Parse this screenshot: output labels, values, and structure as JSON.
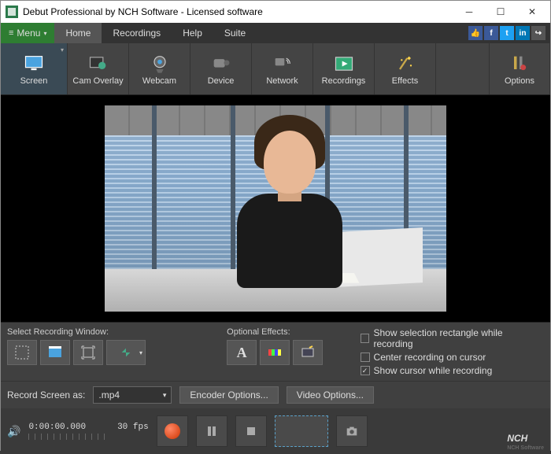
{
  "window": {
    "title": "Debut Professional by NCH Software - Licensed software"
  },
  "menu": {
    "button": "Menu",
    "tabs": [
      "Home",
      "Recordings",
      "Help",
      "Suite"
    ],
    "active": 0
  },
  "toolbar": [
    {
      "label": "Screen",
      "icon": "screen"
    },
    {
      "label": "Cam Overlay",
      "icon": "cam-overlay"
    },
    {
      "label": "Webcam",
      "icon": "webcam"
    },
    {
      "label": "Device",
      "icon": "device"
    },
    {
      "label": "Network",
      "icon": "network"
    },
    {
      "label": "Recordings",
      "icon": "recordings"
    },
    {
      "label": "Effects",
      "icon": "effects"
    },
    {
      "label": "Options",
      "icon": "options"
    }
  ],
  "recording_window": {
    "label": "Select Recording Window:"
  },
  "optional_effects": {
    "label": "Optional Effects:"
  },
  "checks": [
    {
      "label": "Show selection rectangle while recording",
      "checked": false
    },
    {
      "label": "Center recording on cursor",
      "checked": false
    },
    {
      "label": "Show cursor while recording",
      "checked": true
    }
  ],
  "format": {
    "label": "Record Screen as:",
    "value": ".mp4",
    "encoder_btn": "Encoder Options...",
    "video_btn": "Video Options..."
  },
  "transport": {
    "timecode": "0:00:00.000",
    "fps": "30 fps"
  },
  "brand": {
    "name": "NCH",
    "sub": "NCH Software"
  }
}
